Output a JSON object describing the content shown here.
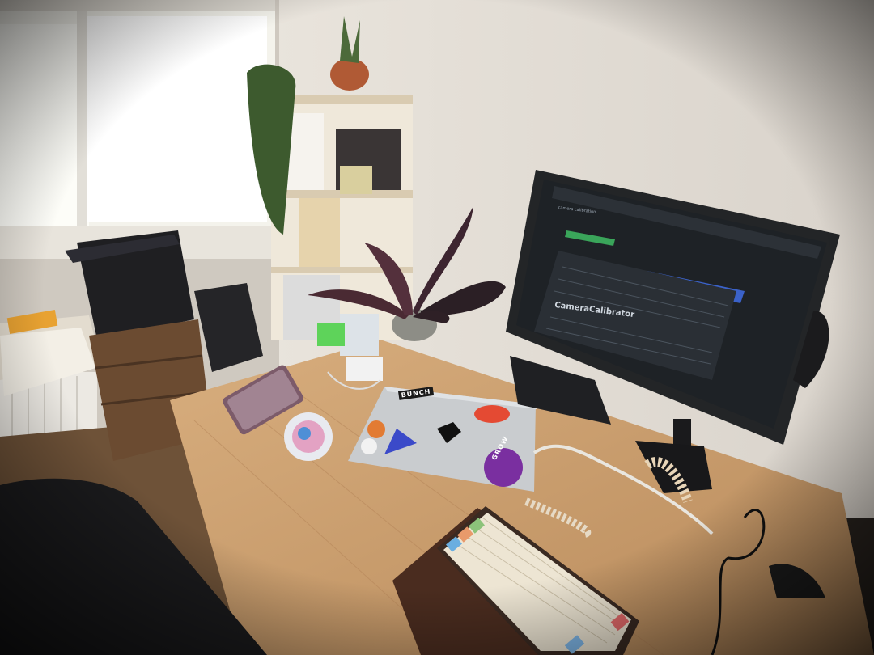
{
  "scene": {
    "description_label": "",
    "monitor_screen": {
      "tab_title": "camera calibration",
      "heading": "CameraCalibrator"
    },
    "stickers": [
      {
        "label": "BUNCH"
      },
      {
        "label": "GROW"
      }
    ]
  },
  "colors": {
    "wall": "#ece8e3",
    "desk": "#c79b69",
    "window": "#fbfbf5",
    "screen_bg": "#1e2226",
    "laptop": "#c9cccf"
  }
}
